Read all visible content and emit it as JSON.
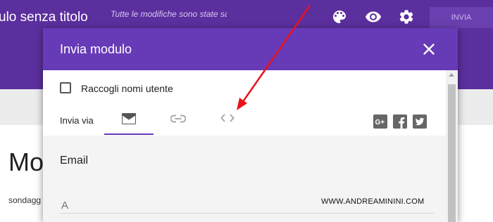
{
  "topbar": {
    "doc_title": "ulo senza titolo",
    "save_status": "Tutte le modifiche sono state salvate in Drive",
    "icons": [
      "palette-icon",
      "eye-icon",
      "gear-icon"
    ],
    "send_label": "INVIA"
  },
  "background": {
    "heading": "Mo",
    "description": "sondagg"
  },
  "dialog": {
    "title": "Invia modulo",
    "close_icon": "close-icon",
    "collect_usernames_label": "Raccogli nomi utente",
    "collect_usernames_checked": false,
    "send_via_label": "Invia via",
    "tabs": [
      {
        "icon": "email-icon",
        "active": true
      },
      {
        "icon": "link-icon",
        "active": false
      },
      {
        "icon": "embed-code-icon",
        "active": false
      }
    ],
    "social": [
      "google-plus-icon",
      "facebook-icon",
      "twitter-icon"
    ],
    "email_panel": {
      "heading": "Email",
      "to_placeholder": "A"
    },
    "watermark": "WWW.ANDREAMININI.COM"
  },
  "colors": {
    "header_purple": "#673ab7",
    "topbar_purple": "#5b2f9d",
    "arrow_red": "#e8121c"
  }
}
